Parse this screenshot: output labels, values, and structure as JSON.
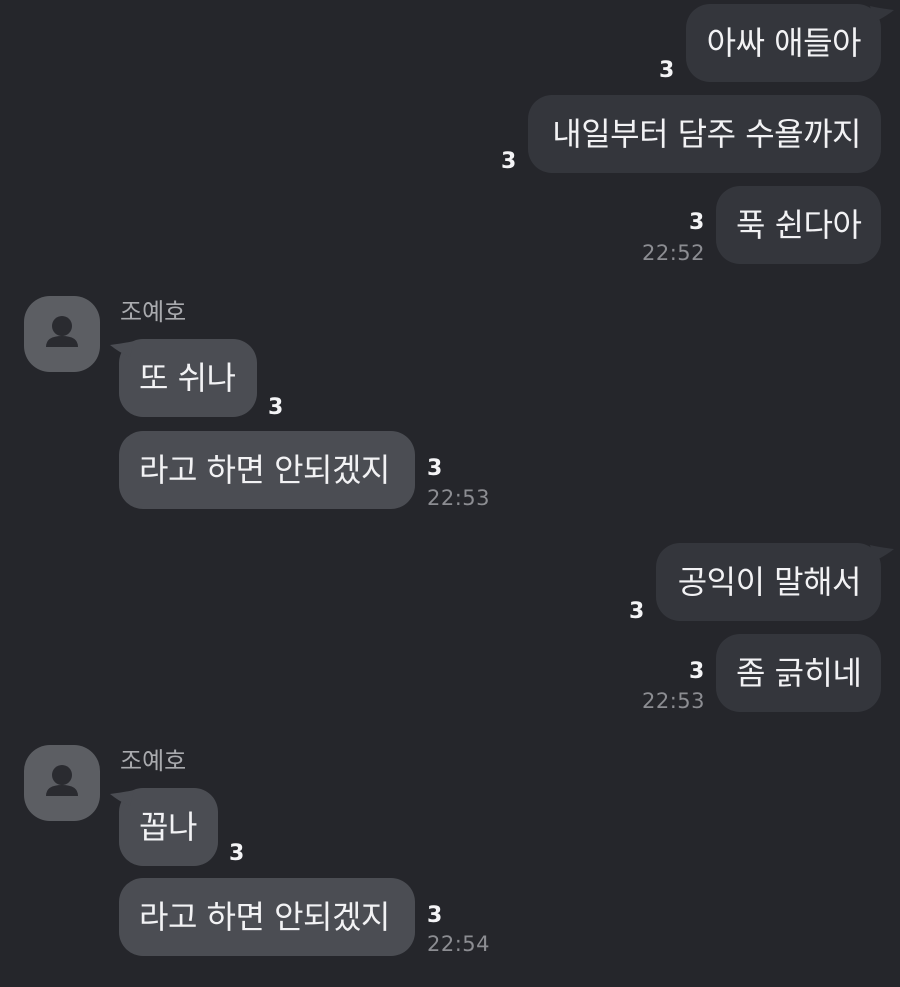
{
  "messages": {
    "m1": {
      "text": "아싸 애들아",
      "unread": "3"
    },
    "m2": {
      "text": "내일부터 담주 수욜까지",
      "unread": "3"
    },
    "m3": {
      "text": "푹 쉰다아",
      "unread": "3",
      "time": "22:52"
    },
    "g1": {
      "sender": "조예호",
      "m4": {
        "text": "또 쉬나",
        "unread": "3"
      },
      "m5": {
        "text": "라고 하면 안되겠지",
        "unread": "3",
        "time": "22:53"
      }
    },
    "m6": {
      "text": "공익이 말해서",
      "unread": "3"
    },
    "m7": {
      "text": "좀 긁히네",
      "unread": "3",
      "time": "22:53"
    },
    "g2": {
      "sender": "조예호",
      "m8": {
        "text": "꼽나",
        "unread": "3"
      },
      "m9": {
        "text": "라고 하면 안되겠지",
        "unread": "3",
        "time": "22:54"
      }
    }
  },
  "colors": {
    "background": "#25262b",
    "my_bubble": "#34363c",
    "their_bubble": "#4b4d53",
    "text": "#f2f2f4",
    "timestamp": "#8c8d92",
    "avatar": "#5c5e63"
  },
  "icons": {
    "avatar": "default-person-icon"
  }
}
